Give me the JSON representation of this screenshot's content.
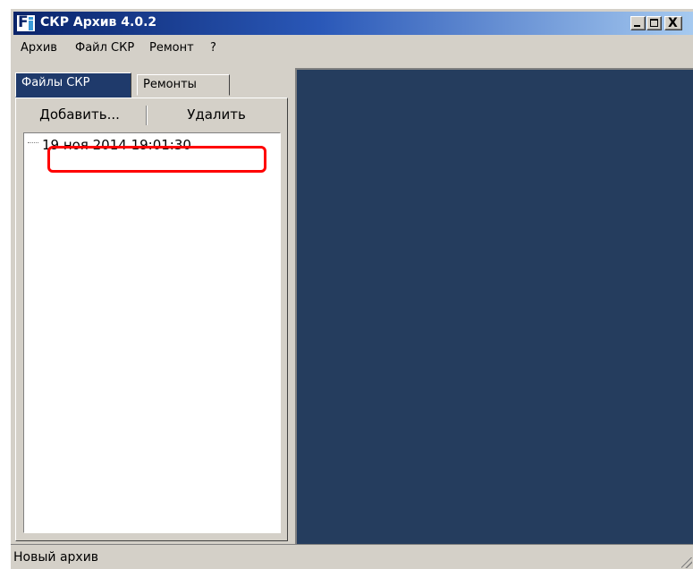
{
  "window": {
    "title": "СКР Архив 4.0.2",
    "controls": {
      "minimize": "_",
      "maximize": "□",
      "close": "X"
    }
  },
  "menu": [
    "Архив",
    "Файл СКР",
    "Ремонт",
    "?"
  ],
  "tabs": [
    {
      "label": "Файлы СКР",
      "active": true
    },
    {
      "label": "Ремонты",
      "active": false
    }
  ],
  "toolbar": {
    "add_label": "Добавить...",
    "delete_label": "Удалить"
  },
  "tree": {
    "items": [
      "19 ноя 2014 19:01:30"
    ]
  },
  "statusbar": {
    "text": "Новый архив"
  },
  "colors": {
    "workspace": "#253d5e",
    "highlight": "#ff0000",
    "active_tab": "#1f3a6b"
  },
  "icons": {
    "app": "app-logo-icon",
    "resize": "resize-grip-icon"
  }
}
